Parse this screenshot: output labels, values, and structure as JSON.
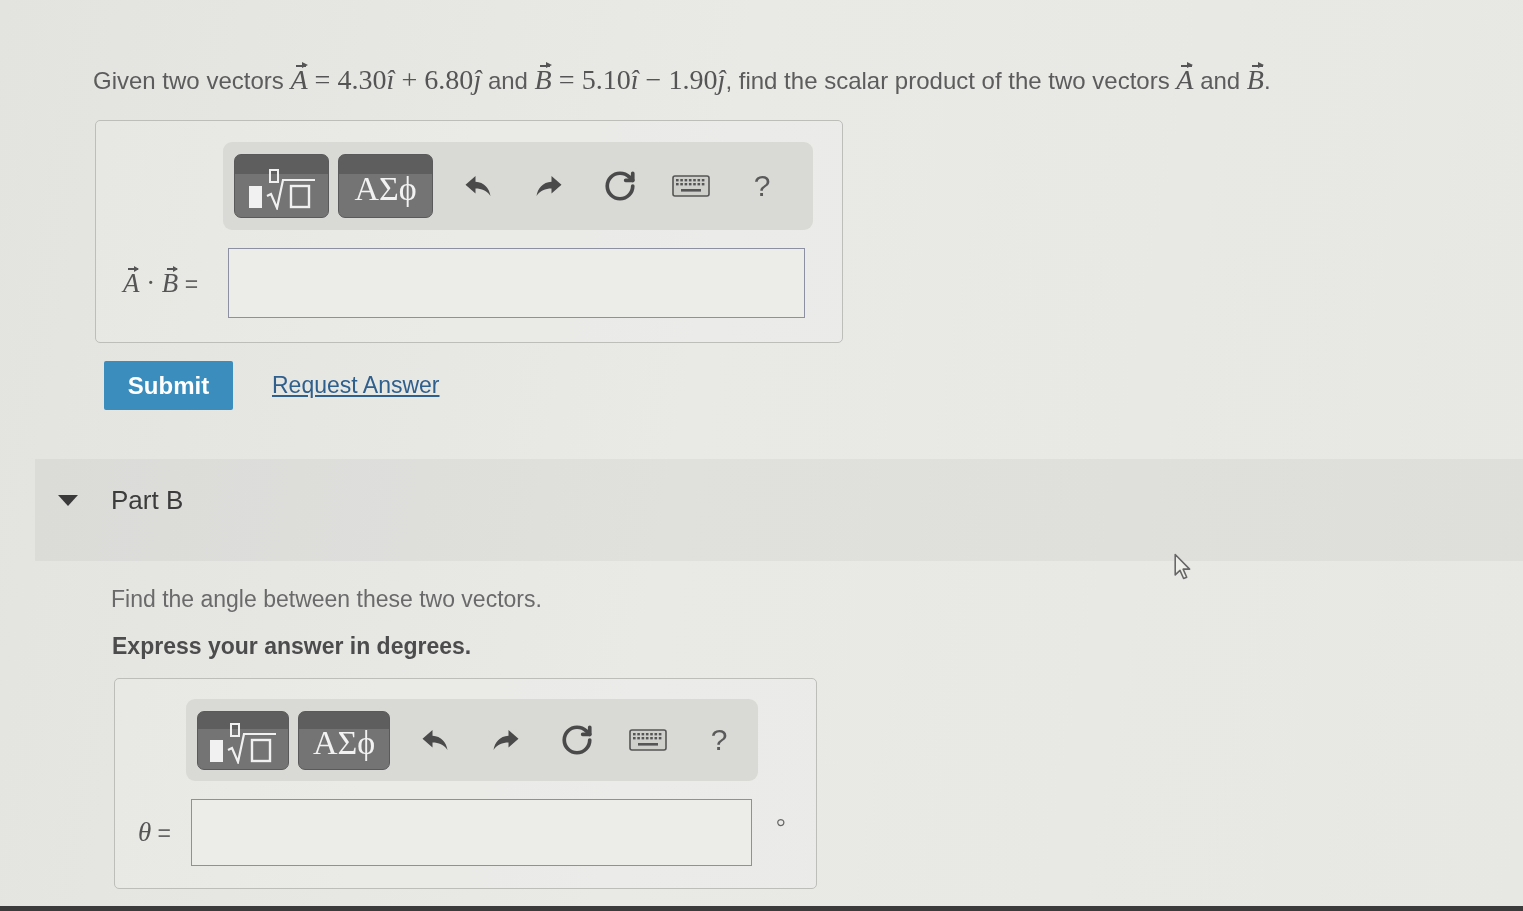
{
  "part_a": {
    "question": [
      {
        "kind": "text",
        "text": "Given two vectors "
      },
      {
        "kind": "vector",
        "text": "A"
      },
      {
        "kind": "math",
        "text": " = 4.30"
      },
      {
        "kind": "unit",
        "text": "î"
      },
      {
        "kind": "math",
        "text": " + 6.80"
      },
      {
        "kind": "unit",
        "text": "ĵ"
      },
      {
        "kind": "text",
        "text": " and "
      },
      {
        "kind": "vector",
        "text": "B"
      },
      {
        "kind": "math",
        "text": " = 5.10"
      },
      {
        "kind": "unit",
        "text": "î"
      },
      {
        "kind": "math",
        "text": " − 1.90"
      },
      {
        "kind": "unit",
        "text": "ĵ"
      },
      {
        "kind": "text",
        "text": ", find the scalar product of the two vectors "
      },
      {
        "kind": "vector",
        "text": "A"
      },
      {
        "kind": "text",
        "text": " and "
      },
      {
        "kind": "vector",
        "text": "B"
      },
      {
        "kind": "text",
        "text": "."
      }
    ],
    "toolbar": [
      {
        "kind": "templates"
      },
      {
        "kind": "symbols",
        "label": "ΑΣϕ"
      },
      {
        "kind": "undo"
      },
      {
        "kind": "redo"
      },
      {
        "kind": "reset"
      },
      {
        "kind": "keyboard"
      },
      {
        "kind": "help",
        "label": "?"
      }
    ],
    "answer_label": [
      {
        "kind": "vector",
        "text": "A"
      },
      {
        "kind": "math",
        "text": " · "
      },
      {
        "kind": "vector",
        "text": "B"
      },
      {
        "kind": "text",
        "text": " ="
      }
    ],
    "actions": [
      {
        "kind": "button",
        "label": "Submit"
      },
      {
        "kind": "link",
        "label": "Request Answer"
      }
    ]
  },
  "part_b": {
    "title": "Part B",
    "expanded": true,
    "prompt": "Find the angle between these two vectors.",
    "instruction": "Express your answer in degrees.",
    "toolbar": [
      {
        "kind": "templates"
      },
      {
        "kind": "symbols",
        "label": "ΑΣϕ"
      },
      {
        "kind": "undo"
      },
      {
        "kind": "redo"
      },
      {
        "kind": "reset"
      },
      {
        "kind": "keyboard"
      },
      {
        "kind": "help",
        "label": "?"
      }
    ],
    "answer_label": [
      {
        "kind": "unit",
        "text": "θ"
      },
      {
        "kind": "text",
        "text": " ="
      }
    ],
    "unit": "°"
  }
}
